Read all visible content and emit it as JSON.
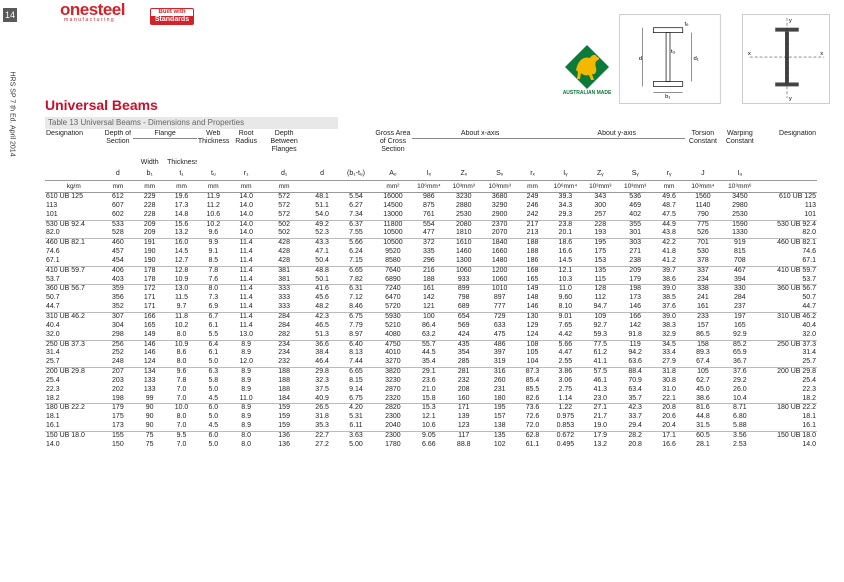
{
  "page": {
    "number": "14",
    "side_label": "HRS SP 7 th Ed. April 2014",
    "logo_main": "onesteel",
    "logo_sub": "manufacturing",
    "standards_top": "Built with",
    "standards_main": "Standards",
    "title": "Universal Beams",
    "subtitle": "Table 13 Universal Beams - Dimensions and Properties",
    "made_label": "AUSTRALIAN MADE"
  },
  "colors": {
    "brand_red": "#d2232a",
    "title_red": "#c8102e",
    "made_green": "#0b7a3b",
    "made_gold": "#f5b800"
  },
  "table": {
    "group_headers": {
      "flange": "Flange",
      "about_x": "About x-axis",
      "about_y": "About y-axis"
    },
    "headers": {
      "designation": "Designation",
      "depth": "Depth of Section",
      "width": "Width",
      "thickness": "Thickness",
      "web": "Web Thickness",
      "root": "Root Radius",
      "depth_between": "Depth Between Flanges",
      "gross": "Gross Area of Cross Section",
      "torsion": "Torsion Constant",
      "warping": "Warping Constant",
      "designation_r": "Designation"
    },
    "symbols": [
      "d",
      "b₁",
      "t₁",
      "tᵤ",
      "r₁",
      "d₁",
      "d",
      "(b₁-tᵤ)",
      "Aₒ",
      "Iₓ",
      "Zₓ",
      "Sₓ",
      "rₓ",
      "Iᵧ",
      "Zᵧ",
      "Sᵧ",
      "rᵧ",
      "J",
      "Iᵤ",
      ""
    ],
    "symbol_subs": [
      "",
      "",
      "",
      "",
      "",
      "",
      "tᵤ",
      "2t₁",
      "",
      "",
      "",
      "",
      "",
      "",
      "",
      "",
      "",
      "",
      "",
      ""
    ],
    "units": [
      "kg/m",
      "mm",
      "mm",
      "mm",
      "mm",
      "mm",
      "mm",
      "",
      "",
      "mm²",
      "10⁶mm⁴",
      "10³mm³",
      "10³mm³",
      "mm",
      "10⁶mm⁴",
      "10³mm³",
      "10³mm³",
      "mm",
      "10³mm⁴",
      "10⁹mm⁶",
      ""
    ],
    "rows": [
      [
        "610 UB 125",
        "612",
        "229",
        "19.6",
        "11.9",
        "14.0",
        "572",
        "48.1",
        "5.54",
        "16000",
        "986",
        "3230",
        "3680",
        "249",
        "39.3",
        "343",
        "536",
        "49.6",
        "1560",
        "3450",
        "610 UB 125"
      ],
      [
        "113",
        "607",
        "228",
        "17.3",
        "11.2",
        "14.0",
        "572",
        "51.1",
        "6.27",
        "14500",
        "875",
        "2880",
        "3290",
        "246",
        "34.3",
        "300",
        "469",
        "48.7",
        "1140",
        "2980",
        "113"
      ],
      [
        "101",
        "602",
        "228",
        "14.8",
        "10.6",
        "14.0",
        "572",
        "54.0",
        "7.34",
        "13000",
        "761",
        "2530",
        "2900",
        "242",
        "29.3",
        "257",
        "402",
        "47.5",
        "790",
        "2530",
        "101"
      ],
      [
        "530 UB 92.4",
        "533",
        "209",
        "15.6",
        "10.2",
        "14.0",
        "502",
        "49.2",
        "6.37",
        "11800",
        "554",
        "2080",
        "2370",
        "217",
        "23.8",
        "228",
        "355",
        "44.9",
        "775",
        "1590",
        "530 UB 92.4"
      ],
      [
        "82.0",
        "528",
        "209",
        "13.2",
        "9.6",
        "14.0",
        "502",
        "52.3",
        "7.55",
        "10500",
        "477",
        "1810",
        "2070",
        "213",
        "20.1",
        "193",
        "301",
        "43.8",
        "526",
        "1330",
        "82.0"
      ],
      [
        "460 UB 82.1",
        "460",
        "191",
        "16.0",
        "9.9",
        "11.4",
        "428",
        "43.3",
        "5.66",
        "10500",
        "372",
        "1610",
        "1840",
        "188",
        "18.6",
        "195",
        "303",
        "42.2",
        "701",
        "919",
        "460 UB 82.1"
      ],
      [
        "74.6",
        "457",
        "190",
        "14.5",
        "9.1",
        "11.4",
        "428",
        "47.1",
        "6.24",
        "9520",
        "335",
        "1460",
        "1660",
        "188",
        "16.6",
        "175",
        "271",
        "41.8",
        "530",
        "815",
        "74.6"
      ],
      [
        "67.1",
        "454",
        "190",
        "12.7",
        "8.5",
        "11.4",
        "428",
        "50.4",
        "7.15",
        "8580",
        "296",
        "1300",
        "1480",
        "186",
        "14.5",
        "153",
        "238",
        "41.2",
        "378",
        "708",
        "67.1"
      ],
      [
        "410 UB 59.7",
        "406",
        "178",
        "12.8",
        "7.8",
        "11.4",
        "381",
        "48.8",
        "6.65",
        "7640",
        "216",
        "1060",
        "1200",
        "168",
        "12.1",
        "135",
        "209",
        "39.7",
        "337",
        "467",
        "410 UB 59.7"
      ],
      [
        "53.7",
        "403",
        "178",
        "10.9",
        "7.6",
        "11.4",
        "381",
        "50.1",
        "7.82",
        "6890",
        "188",
        "933",
        "1060",
        "165",
        "10.3",
        "115",
        "179",
        "38.6",
        "234",
        "394",
        "53.7"
      ],
      [
        "360 UB 56.7",
        "359",
        "172",
        "13.0",
        "8.0",
        "11.4",
        "333",
        "41.6",
        "6.31",
        "7240",
        "161",
        "899",
        "1010",
        "149",
        "11.0",
        "128",
        "198",
        "39.0",
        "338",
        "330",
        "360 UB 56.7"
      ],
      [
        "50.7",
        "356",
        "171",
        "11.5",
        "7.3",
        "11.4",
        "333",
        "45.6",
        "7.12",
        "6470",
        "142",
        "798",
        "897",
        "148",
        "9.60",
        "112",
        "173",
        "38.5",
        "241",
        "284",
        "50.7"
      ],
      [
        "44.7",
        "352",
        "171",
        "9.7",
        "6.9",
        "11.4",
        "333",
        "48.2",
        "8.46",
        "5720",
        "121",
        "689",
        "777",
        "146",
        "8.10",
        "94.7",
        "146",
        "37.6",
        "161",
        "237",
        "44.7"
      ],
      [
        "310 UB 46.2",
        "307",
        "166",
        "11.8",
        "6.7",
        "11.4",
        "284",
        "42.3",
        "6.75",
        "5930",
        "100",
        "654",
        "729",
        "130",
        "9.01",
        "109",
        "166",
        "39.0",
        "233",
        "197",
        "310 UB 46.2"
      ],
      [
        "40.4",
        "304",
        "165",
        "10.2",
        "6.1",
        "11.4",
        "284",
        "46.5",
        "7.79",
        "5210",
        "86.4",
        "569",
        "633",
        "129",
        "7.65",
        "92.7",
        "142",
        "38.3",
        "157",
        "165",
        "40.4"
      ],
      [
        "32.0",
        "298",
        "149",
        "8.0",
        "5.5",
        "13.0",
        "282",
        "51.3",
        "8.97",
        "4080",
        "63.2",
        "424",
        "475",
        "124",
        "4.42",
        "59.3",
        "91.8",
        "32.9",
        "86.5",
        "92.9",
        "32.0"
      ],
      [
        "250 UB 37.3",
        "256",
        "146",
        "10.9",
        "6.4",
        "8.9",
        "234",
        "36.6",
        "6.40",
        "4750",
        "55.7",
        "435",
        "486",
        "108",
        "5.66",
        "77.5",
        "119",
        "34.5",
        "158",
        "85.2",
        "250 UB 37.3"
      ],
      [
        "31.4",
        "252",
        "146",
        "8.6",
        "6.1",
        "8.9",
        "234",
        "38.4",
        "8.13",
        "4010",
        "44.5",
        "354",
        "397",
        "105",
        "4.47",
        "61.2",
        "94.2",
        "33.4",
        "89.3",
        "65.9",
        "31.4"
      ],
      [
        "25.7",
        "248",
        "124",
        "8.0",
        "5.0",
        "12.0",
        "232",
        "46.4",
        "7.44",
        "3270",
        "35.4",
        "285",
        "319",
        "104",
        "2.55",
        "41.1",
        "63.6",
        "27.9",
        "67.4",
        "36.7",
        "25.7"
      ],
      [
        "200 UB 29.8",
        "207",
        "134",
        "9.6",
        "6.3",
        "8.9",
        "188",
        "29.8",
        "6.65",
        "3820",
        "29.1",
        "281",
        "316",
        "87.3",
        "3.86",
        "57.5",
        "88.4",
        "31.8",
        "105",
        "37.6",
        "200 UB 29.8"
      ],
      [
        "25.4",
        "203",
        "133",
        "7.8",
        "5.8",
        "8.9",
        "188",
        "32.3",
        "8.15",
        "3230",
        "23.6",
        "232",
        "260",
        "85.4",
        "3.06",
        "46.1",
        "70.9",
        "30.8",
        "62.7",
        "29.2",
        "25.4"
      ],
      [
        "22.3",
        "202",
        "133",
        "7.0",
        "5.0",
        "8.9",
        "188",
        "37.5",
        "9.14",
        "2870",
        "21.0",
        "208",
        "231",
        "85.5",
        "2.75",
        "41.3",
        "63.4",
        "31.0",
        "45.0",
        "26.0",
        "22.3"
      ],
      [
        "18.2",
        "198",
        "99",
        "7.0",
        "4.5",
        "11.0",
        "184",
        "40.9",
        "6.75",
        "2320",
        "15.8",
        "160",
        "180",
        "82.6",
        "1.14",
        "23.0",
        "35.7",
        "22.1",
        "38.6",
        "10.4",
        "18.2"
      ],
      [
        "180 UB 22.2",
        "179",
        "90",
        "10.0",
        "6.0",
        "8.9",
        "159",
        "26.5",
        "4.20",
        "2820",
        "15.3",
        "171",
        "195",
        "73.6",
        "1.22",
        "27.1",
        "42.3",
        "20.8",
        "81.6",
        "8.71",
        "180 UB 22.2"
      ],
      [
        "18.1",
        "175",
        "90",
        "8.0",
        "5.0",
        "8.9",
        "159",
        "31.8",
        "5.31",
        "2300",
        "12.1",
        "139",
        "157",
        "72.6",
        "0.975",
        "21.7",
        "33.7",
        "20.6",
        "44.8",
        "6.80",
        "18.1"
      ],
      [
        "16.1",
        "173",
        "90",
        "7.0",
        "4.5",
        "8.9",
        "159",
        "35.3",
        "6.11",
        "2040",
        "10.6",
        "123",
        "138",
        "72.0",
        "0.853",
        "19.0",
        "29.4",
        "20.4",
        "31.5",
        "5.88",
        "16.1"
      ],
      [
        "150 UB 18.0",
        "155",
        "75",
        "9.5",
        "6.0",
        "8.0",
        "136",
        "22.7",
        "3.63",
        "2300",
        "9.05",
        "117",
        "135",
        "62.8",
        "0.672",
        "17.9",
        "28.2",
        "17.1",
        "60.5",
        "3.56",
        "150 UB 18.0"
      ],
      [
        "14.0",
        "150",
        "75",
        "7.0",
        "5.0",
        "8.0",
        "136",
        "27.2",
        "5.00",
        "1780",
        "6.66",
        "88.8",
        "102",
        "61.1",
        "0.495",
        "13.2",
        "20.8",
        "16.6",
        "28.1",
        "2.53",
        "14.0"
      ]
    ],
    "group_starts": [
      3,
      5,
      8,
      10,
      13,
      16,
      19,
      23,
      26
    ]
  }
}
